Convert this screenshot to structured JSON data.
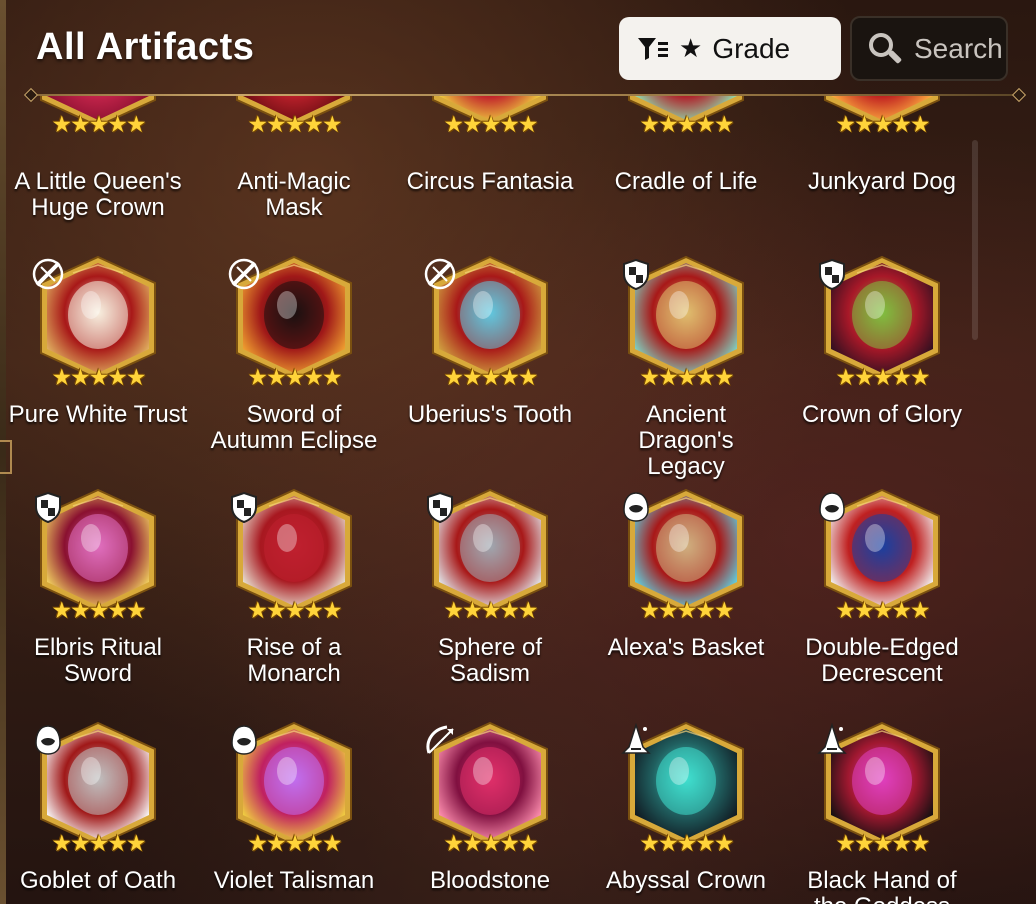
{
  "header": {
    "title": "All Artifacts",
    "grade_label": "Grade",
    "grade_star": "★",
    "search_label": "Search"
  },
  "colors": {
    "star": "#ffd43a",
    "frame_gold": "#d8a93a",
    "grade_bg": "#f4f2ee",
    "search_bg": "#1a1410"
  },
  "rows": [
    [
      {
        "name": "A Little Queen's Huge Crown",
        "lines": [
          "A Little Queen's",
          "Huge Crown"
        ],
        "stars": 5,
        "class": "none",
        "art": [
          "#c2244a",
          "#f0a030",
          "#8a1030"
        ]
      },
      {
        "name": "Anti-Magic Mask",
        "lines": [
          "Anti-Magic",
          "Mask"
        ],
        "stars": 5,
        "class": "none",
        "art": [
          "#b8202a",
          "#f2efe8",
          "#6a0d12"
        ]
      },
      {
        "name": "Circus Fantasia",
        "lines": [
          "Circus Fantasia"
        ],
        "stars": 5,
        "class": "none",
        "art": [
          "#c0202a",
          "#2a4ab0",
          "#f0d040"
        ]
      },
      {
        "name": "Cradle of Life",
        "lines": [
          "Cradle of Life"
        ],
        "stars": 5,
        "class": "none",
        "art": [
          "#b01e28",
          "#1a9a60",
          "#8fe0b0"
        ]
      },
      {
        "name": "Junkyard Dog",
        "lines": [
          "Junkyard Dog"
        ],
        "stars": 5,
        "class": "none",
        "art": [
          "#c02020",
          "#f06020",
          "#ffb040"
        ]
      }
    ],
    [
      {
        "name": "Pure White Trust",
        "lines": [
          "Pure White Trust"
        ],
        "stars": 5,
        "class": "warrior-icon",
        "art": [
          "#a81818",
          "#f8f0e0",
          "#e0b060"
        ]
      },
      {
        "name": "Sword of Autumn Eclipse",
        "lines": [
          "Sword of",
          "Autumn Eclipse"
        ],
        "stars": 5,
        "class": "warrior-icon",
        "art": [
          "#a01818",
          "#1a1010",
          "#f0a030"
        ]
      },
      {
        "name": "Uberius's Tooth",
        "lines": [
          "Uberius's Tooth"
        ],
        "stars": 5,
        "class": "warrior-icon",
        "art": [
          "#a81818",
          "#60c8e0",
          "#d0a040"
        ]
      },
      {
        "name": "Ancient Dragon's Legacy",
        "lines": [
          "Ancient",
          "Dragon's",
          "Legacy"
        ],
        "stars": 5,
        "class": "knight-icon",
        "art": [
          "#a81818",
          "#e0c070",
          "#80d0c0"
        ]
      },
      {
        "name": "Crown of Glory",
        "lines": [
          "Crown of Glory"
        ],
        "stars": 5,
        "class": "knight-icon",
        "art": [
          "#a81828",
          "#80c040",
          "#301020"
        ]
      }
    ],
    [
      {
        "name": "Elbris Ritual Sword",
        "lines": [
          "Elbris Ritual",
          "Sword"
        ],
        "stars": 5,
        "class": "knight-icon",
        "art": [
          "#8a1030",
          "#e070c0",
          "#f0d060"
        ]
      },
      {
        "name": "Rise of a Monarch",
        "lines": [
          "Rise of a",
          "Monarch"
        ],
        "stars": 5,
        "class": "knight-icon",
        "art": [
          "#a81820",
          "#c02030",
          "#e8e0d0"
        ]
      },
      {
        "name": "Sphere of Sadism",
        "lines": [
          "Sphere of",
          "Sadism"
        ],
        "stars": 5,
        "class": "knight-icon",
        "art": [
          "#a81818",
          "#a0a8b0",
          "#e0e4e8"
        ]
      },
      {
        "name": "Alexa's Basket",
        "lines": [
          "Alexa's Basket"
        ],
        "stars": 5,
        "class": "thief-icon",
        "art": [
          "#a81818",
          "#d0b080",
          "#60d0e0"
        ]
      },
      {
        "name": "Double-Edged Decrescent",
        "lines": [
          "Double-Edged",
          "Decrescent"
        ],
        "stars": 5,
        "class": "thief-icon",
        "art": [
          "#c02020",
          "#1a40a0",
          "#f0f0f0"
        ]
      }
    ],
    [
      {
        "name": "Goblet of Oath",
        "lines": [
          "Goblet of Oath"
        ],
        "stars": 5,
        "class": "thief-icon",
        "art": [
          "#a01818",
          "#c0c0c0",
          "#f8f8f8"
        ]
      },
      {
        "name": "Violet Talisman",
        "lines": [
          "Violet Talisman"
        ],
        "stars": 5,
        "class": "thief-icon",
        "art": [
          "#c02060",
          "#c070f0",
          "#f0d040"
        ]
      },
      {
        "name": "Bloodstone",
        "lines": [
          "Bloodstone"
        ],
        "stars": 5,
        "class": "ranger-icon",
        "art": [
          "#801040",
          "#e0306a",
          "#ff90b0"
        ]
      },
      {
        "name": "Abyssal Crown",
        "lines": [
          "Abyssal Crown"
        ],
        "stars": 5,
        "class": "mage-icon",
        "art": [
          "#206060",
          "#40e0d0",
          "#101820"
        ]
      },
      {
        "name": "Black Hand of the Goddess",
        "lines": [
          "Black Hand of",
          "the Goddess"
        ],
        "stars": 5,
        "class": "mage-icon",
        "art": [
          "#a01830",
          "#e040c0",
          "#101010"
        ]
      }
    ]
  ]
}
